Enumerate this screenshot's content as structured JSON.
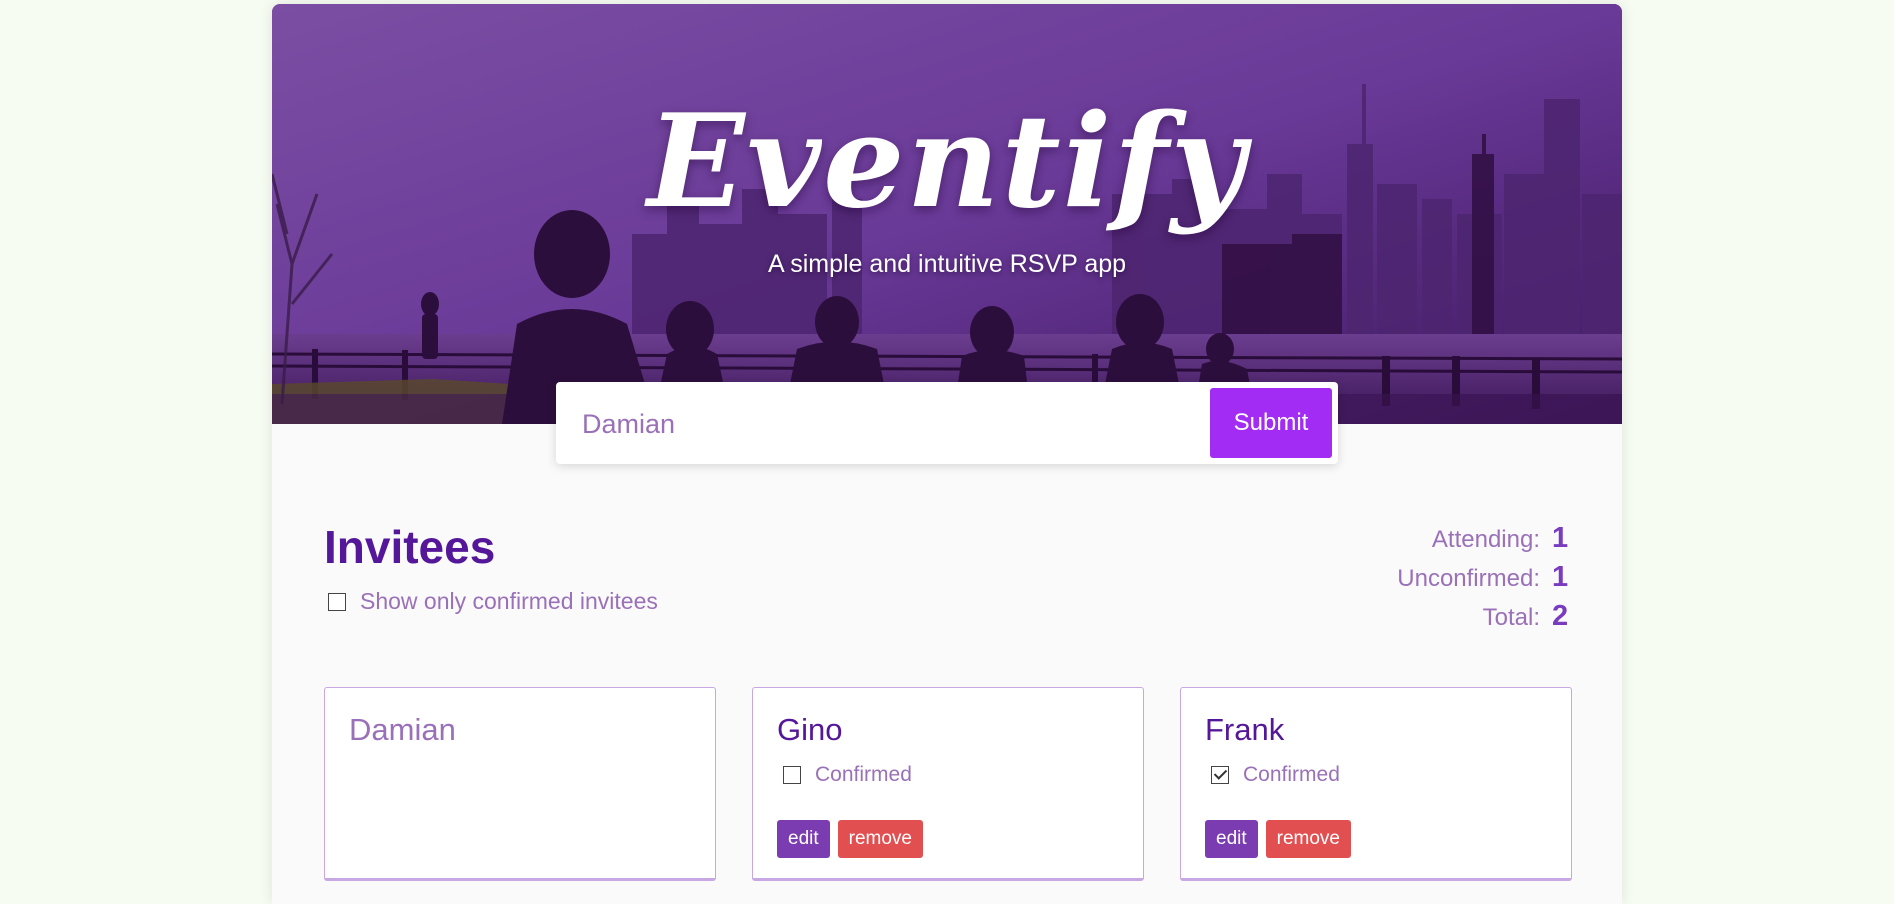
{
  "header": {
    "title": "Eventify",
    "subtitle": "A simple and intuitive RSVP app"
  },
  "form": {
    "input_value": "Damian",
    "submit_label": "Submit"
  },
  "invitees": {
    "heading": "Invitees",
    "filter_label": "Show only confirmed invitees",
    "filter_checked": false
  },
  "stats": {
    "attending_label": "Attending:",
    "attending_value": "1",
    "unconfirmed_label": "Unconfirmed:",
    "unconfirmed_value": "1",
    "total_label": "Total:",
    "total_value": "2"
  },
  "cards": [
    {
      "name": "Damian"
    },
    {
      "name": "Gino",
      "confirmed_label": "Confirmed",
      "confirmed": false,
      "edit_label": "edit",
      "remove_label": "remove"
    },
    {
      "name": "Frank",
      "confirmed_label": "Confirmed",
      "confirmed": true,
      "edit_label": "edit",
      "remove_label": "remove"
    }
  ],
  "colors": {
    "accent": "#a32cf5",
    "heading": "#541799",
    "muted": "#9a71b8",
    "edit": "#7a3cb0",
    "remove": "#e24f51"
  }
}
